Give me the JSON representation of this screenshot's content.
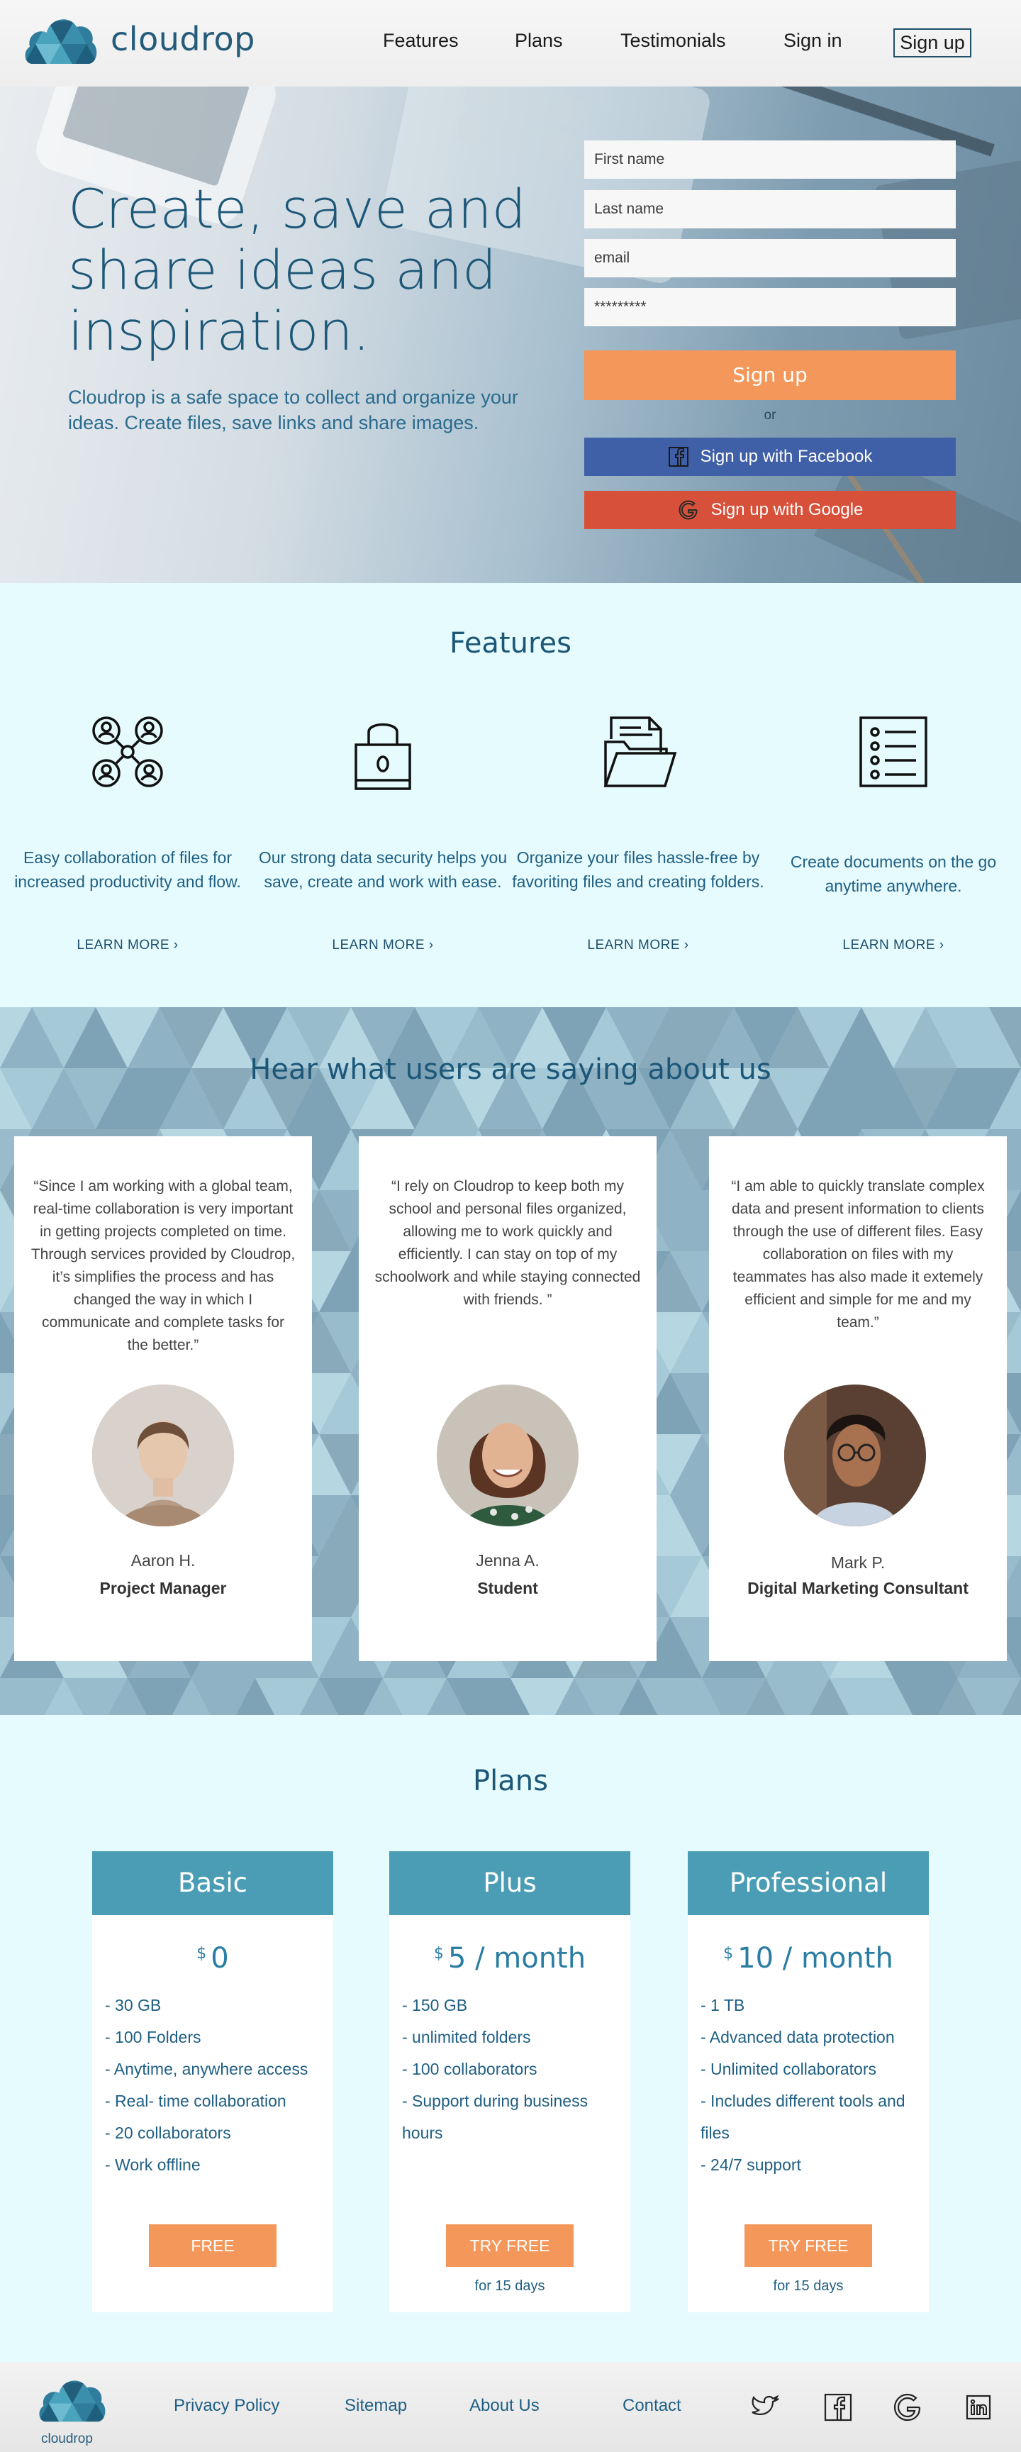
{
  "nav": {
    "brand": "cloudrop",
    "links": [
      "Features",
      "Plans",
      "Testimonials",
      "Sign in"
    ],
    "signup_label": "Sign up"
  },
  "hero": {
    "title": "Create, save and share ideas and inspiration.",
    "subtitle": "Cloudrop is a safe space to collect and organize your ideas. Create files, save links and share images.",
    "form": {
      "first_name_placeholder": "First name",
      "last_name_placeholder": "Last name",
      "email_placeholder": "email",
      "password_value": "*********",
      "signup_label": "Sign up",
      "or_label": "or",
      "facebook_label": "Sign up with Facebook",
      "google_label": "Sign up with Google"
    }
  },
  "features": {
    "title": "Features",
    "items": [
      {
        "icon": "collaboration-icon",
        "text": "Easy collaboration of files for increased productivity and flow.",
        "link": "LEARN MORE"
      },
      {
        "icon": "lock-icon",
        "text": "Our strong data security helps you save, create and work with ease.",
        "link": "LEARN MORE"
      },
      {
        "icon": "folder-icon",
        "text": "Organize your files hassle-free by favoriting files and creating folders.",
        "link": "LEARN MORE"
      },
      {
        "icon": "checklist-icon",
        "text": "Create documents on the go anytime anywhere.",
        "link": "LEARN MORE"
      }
    ]
  },
  "testimonials": {
    "title": "Hear what users are saying about us",
    "items": [
      {
        "quote": "“Since I am working with a global team, real-time collaboration is very important in getting projects completed on time. Through services provided by  Cloudrop, it’s simplifies the process and has changed the way in which I communicate and complete tasks for the better.”",
        "name": "Aaron H.",
        "role": "Project Manager"
      },
      {
        "quote": "“I rely on Cloudrop to keep both my school and personal files organized, allowing me to work quickly and efficiently. I can stay on top of my schoolwork and while staying connected with friends. ”",
        "name": "Jenna A.",
        "role": "Student"
      },
      {
        "quote": "“I am able to quickly translate complex data and present information to clients through the use of different files. Easy collaboration on files with my teammates has also made it extemely efficient and simple for me and my team.”",
        "name": "Mark P.",
        "role": "Digital Marketing Consultant"
      }
    ]
  },
  "plans": {
    "title": "Plans",
    "currency": "$",
    "items": [
      {
        "name": "Basic",
        "price": "0",
        "features": [
          "- 30 GB",
          "- 100 Folders",
          "- Anytime, anywhere access",
          "- Real- time collaboration",
          "- 20 collaborators",
          "- Work offline"
        ],
        "button": "FREE",
        "note": ""
      },
      {
        "name": "Plus",
        "price": "5 / month",
        "features": [
          "- 150 GB",
          "- unlimited folders",
          "- 100 collaborators",
          "- Support during business hours"
        ],
        "button": "TRY FREE",
        "note": "for 15 days"
      },
      {
        "name": "Professional",
        "price": "10 / month",
        "features": [
          "- 1 TB",
          "- Advanced data protection",
          "- Unlimited collaborators",
          "- Includes different tools and files",
          "- 24/7 support"
        ],
        "button": "TRY FREE",
        "note": "for 15 days"
      }
    ]
  },
  "footer": {
    "brand": "cloudrop",
    "links": [
      "Privacy Policy",
      "Sitemap",
      "About Us",
      "Contact"
    ],
    "social_icons": [
      "twitter-icon",
      "facebook-icon",
      "google-icon",
      "linkedin-icon"
    ]
  },
  "colors": {
    "brand_blue": "#1c5778",
    "accent_orange": "#f4975a",
    "facebook_blue": "#3f5fa6",
    "google_red": "#d6503a",
    "plan_header": "#4a9db4",
    "section_bg": "#e6fbfd"
  }
}
